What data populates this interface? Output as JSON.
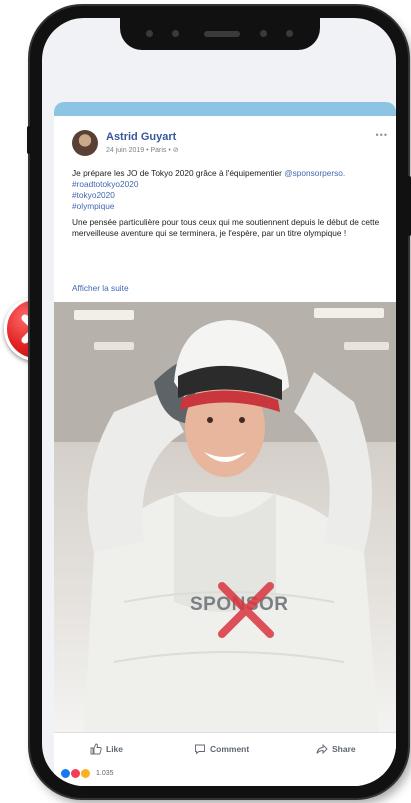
{
  "post": {
    "author": "Astrid Guyart",
    "meta": "24 juin 2019 • Paris • ⊘",
    "more_options": "•••",
    "line1_pre": "Je prépare les JO de Tokyo 2020 grâce à l'équipementier ",
    "line1_mention": "@sponsorperso.",
    "hashtags": [
      "#roadtotokyo2020",
      "#tokyo2020",
      "#olympique"
    ],
    "paragraph2": "Une pensée particulière pour tous ceux qui me soutiennent depuis le début de cette merveilleuse aventure qui se terminera, je l'espère, par un titre olympique !",
    "see_more": "Afficher la suite"
  },
  "photo": {
    "overlay_text": "SPONSOR"
  },
  "actions": {
    "like": "Like",
    "comment": "Comment",
    "share": "Share"
  },
  "reactions": {
    "count": "1.035"
  },
  "colors": {
    "link": "#4267b2",
    "reject_red": "#e02020",
    "cross_red": "#d9363e",
    "header_bar": "#8ec4e3"
  }
}
